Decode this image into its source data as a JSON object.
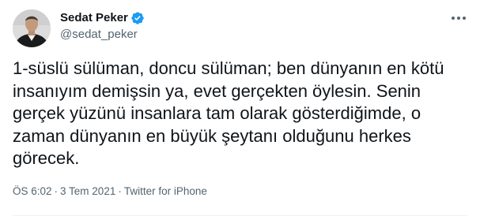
{
  "author": {
    "display_name": "Sedat Peker",
    "handle": "@sedat_peker",
    "verified": true
  },
  "icons": {
    "verified": "verified-badge-icon",
    "more": "more-options-icon"
  },
  "colors": {
    "verified_blue": "#1d9bf0",
    "secondary_text": "#536471",
    "primary_text": "#0f1419"
  },
  "tweet": {
    "lines": [
      "1-süslü sülüman, doncu sülüman; ben dünyanın en kötü",
      "insanıyım demişsin ya, evet gerçekten öylesin. Senin",
      "gerçek yüzünü insanlara tam olarak gösterdiğimde, o",
      "zaman dünyanın en büyük şeytanı olduğunu herkes",
      "görecek."
    ]
  },
  "meta": {
    "time": "ÖS 6:02",
    "separator": "·",
    "date": "3 Tem 2021",
    "source": "Twitter for iPhone"
  }
}
